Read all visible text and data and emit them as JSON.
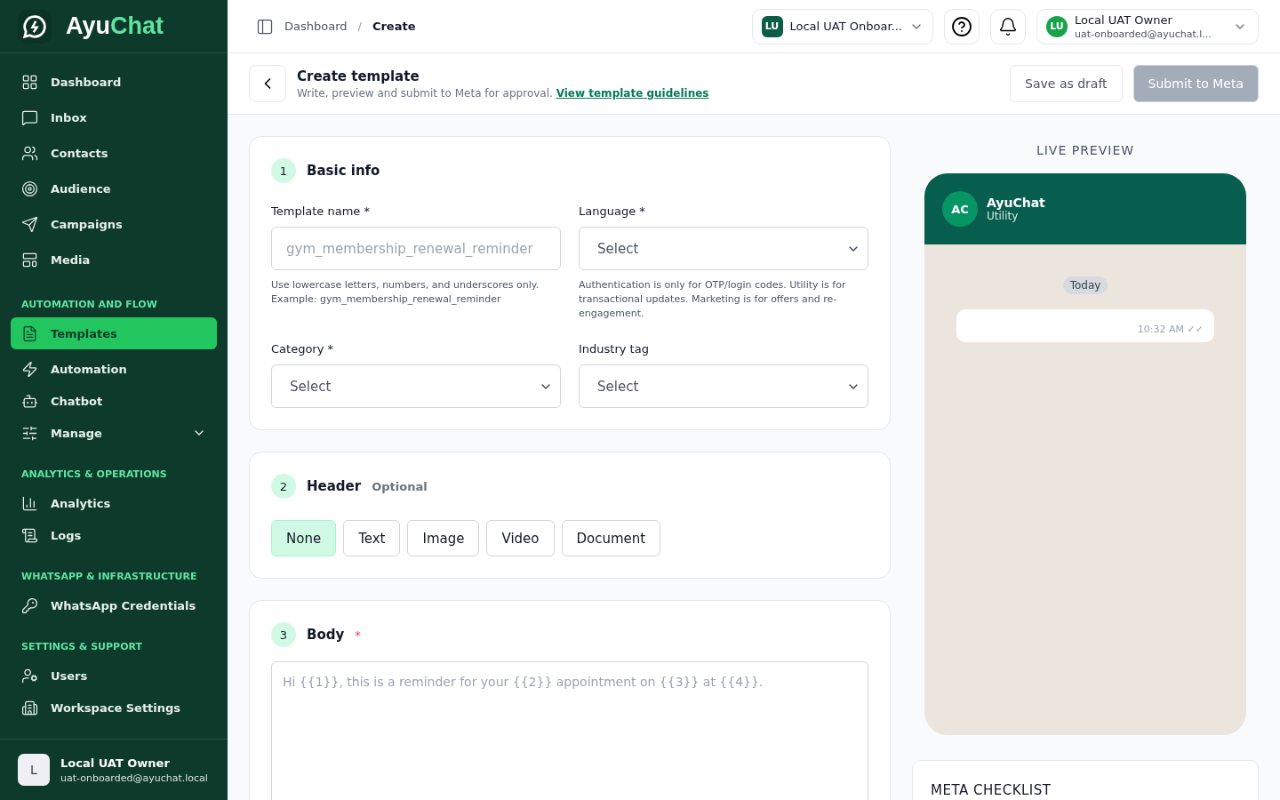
{
  "brand": {
    "first": "Ayu",
    "second": "Chat"
  },
  "sidebar": {
    "sections": [
      {
        "items": [
          {
            "label": "Dashboard",
            "selected": false
          },
          {
            "label": "Inbox",
            "selected": false
          },
          {
            "label": "Contacts",
            "selected": false
          },
          {
            "label": "Audience",
            "selected": false
          },
          {
            "label": "Campaigns",
            "selected": false
          },
          {
            "label": "Media",
            "selected": false
          }
        ]
      },
      {
        "title": "AUTOMATION AND FLOW",
        "items": [
          {
            "label": "Templates",
            "selected": true
          },
          {
            "label": "Automation",
            "selected": false
          },
          {
            "label": "Chatbot",
            "selected": false
          },
          {
            "label": "Manage",
            "selected": false,
            "expandable": true
          }
        ]
      },
      {
        "title": "ANALYTICS & OPERATIONS",
        "items": [
          {
            "label": "Analytics",
            "selected": false
          },
          {
            "label": "Logs",
            "selected": false
          }
        ]
      },
      {
        "title": "WHATSAPP & INFRASTRUCTURE",
        "items": [
          {
            "label": "WhatsApp Credentials",
            "selected": false
          }
        ]
      },
      {
        "title": "SETTINGS & SUPPORT",
        "items": [
          {
            "label": "Users",
            "selected": false
          },
          {
            "label": "Workspace Settings",
            "selected": false
          }
        ]
      }
    ],
    "user": {
      "initial": "L",
      "name": "Local UAT Owner",
      "email": "uat-onboarded@ayuchat.local"
    }
  },
  "topbar": {
    "breadcrumb": [
      "Dashboard",
      "Create"
    ],
    "breadcrumb_separator": "/",
    "workspace": {
      "initials": "LU",
      "name": "Local UAT Onboar..."
    },
    "user": {
      "initials": "LU",
      "name": "Local UAT Owner",
      "email": "uat-onboarded@ayuchat.l..."
    }
  },
  "page_header": {
    "title": "Create template",
    "subtitle": "Write, preview and submit to Meta for approval.",
    "link": "View template guidelines",
    "buttons": [
      {
        "label": "Save as draft",
        "disabled": false
      },
      {
        "label": "Submit to Meta",
        "disabled": true
      }
    ]
  },
  "basic_info": {
    "step": "1",
    "title": "Basic info",
    "fields": [
      {
        "kind": "input",
        "label": "Template name *",
        "placeholder": "gym_membership_renewal_reminder",
        "help": "Use lowercase letters, numbers, and underscores only. Example: gym_membership_renewal_reminder"
      },
      {
        "kind": "select",
        "label": "Language *",
        "value": "Select",
        "help": "Authentication is only for OTP/login codes. Utility is for transactional updates. Marketing is for offers and re-engagement."
      },
      {
        "kind": "select",
        "label": "Category *",
        "value": "Select"
      },
      {
        "kind": "select",
        "label": "Industry tag",
        "value": "Select"
      }
    ]
  },
  "header_section": {
    "step": "2",
    "title": "Header",
    "note": "Optional",
    "options": [
      {
        "label": "None",
        "selected": true
      },
      {
        "label": "Text",
        "selected": false
      },
      {
        "label": "Image",
        "selected": false
      },
      {
        "label": "Video",
        "selected": false
      },
      {
        "label": "Document",
        "selected": false
      }
    ]
  },
  "body_section": {
    "step": "3",
    "title": "Body",
    "required_mark": "*",
    "placeholder": "Hi {{1}}, this is a reminder for your {{2}} appointment on {{3}} at {{4}}."
  },
  "preview": {
    "title": "LIVE PREVIEW",
    "avatar": "AC",
    "name": "AyuChat",
    "subtitle": "Utility",
    "date": "Today",
    "time": "10:32 AM ✓✓"
  },
  "checklist": {
    "title": "META CHECKLIST"
  }
}
